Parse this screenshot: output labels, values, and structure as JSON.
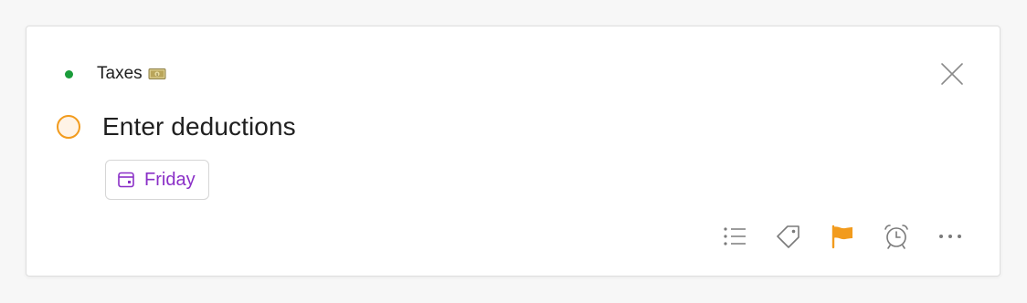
{
  "task": {
    "project": {
      "name": "Taxes",
      "color": "#1a9c3a",
      "emoji_icon": "money-with-wings-emoji"
    },
    "title": "Enter deductions",
    "priority_color": "#f29b1d",
    "due_date": {
      "label": "Friday",
      "color": "#8a2fc7",
      "icon": "calendar-icon"
    }
  },
  "toolbar": {
    "items": [
      {
        "name": "subtasks-icon"
      },
      {
        "name": "label-tag-icon"
      },
      {
        "name": "priority-flag-icon",
        "color": "#f29b1d"
      },
      {
        "name": "alarm-clock-icon"
      },
      {
        "name": "more-options-icon"
      }
    ]
  },
  "close_icon": "close-icon"
}
